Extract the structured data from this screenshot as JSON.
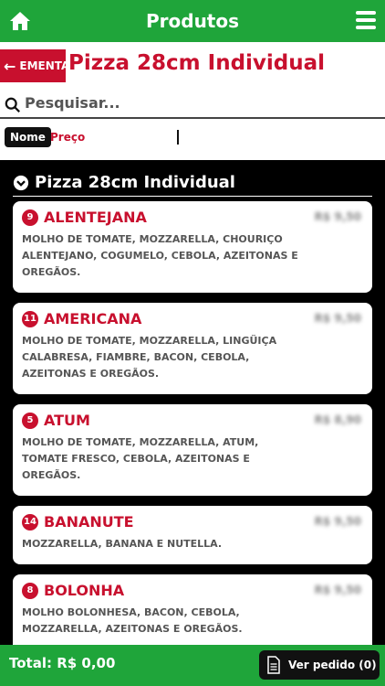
{
  "topbar": {
    "title": "Produtos"
  },
  "header": {
    "back_label": "EMENTA",
    "title": "Pizza 28cm Individual"
  },
  "search": {
    "placeholder": "Pesquisar..."
  },
  "sort": {
    "name_label": "Nome",
    "price_label": "Preço"
  },
  "section": {
    "title": "Pizza 28cm Individual"
  },
  "products": [
    {
      "badge": "9",
      "name": "ALENTEJANA",
      "price": "R$ 9,50",
      "desc_lines": [
        "MOLHO DE TOMATE, MOZZARELLA, CHOURIÇO",
        "ALENTEJANO, COGUMELO, CEBOLA, AZEITONAS E",
        "OREGÃOS."
      ]
    },
    {
      "badge": "11",
      "name": "AMERICANA",
      "price": "R$ 9,50",
      "desc_lines": [
        "MOLHO DE TOMATE, MOZZARELLA, LINGÜIÇA",
        "CALABRESA, FIAMBRE, BACON, CEBOLA,",
        "AZEITONAS E OREGÃOS."
      ]
    },
    {
      "badge": "5",
      "name": "ATUM",
      "price": "R$ 8,90",
      "desc_lines": [
        "MOLHO DE TOMATE, MOZZARELLA, ATUM,",
        "TOMATE FRESCO, CEBOLA, AZEITONAS E",
        "OREGÃOS."
      ]
    },
    {
      "badge": "14",
      "name": "BANANUTE",
      "price": "R$ 9,50",
      "desc_lines": [
        "MOZZARELLA, BANANA E NUTELLA."
      ]
    },
    {
      "badge": "8",
      "name": "BOLONHA",
      "price": "R$ 9,50",
      "desc_lines": [
        "MOLHO BOLONHESA, BACON, CEBOLA,",
        "MOZZARELLA, AZEITONAS E OREGÃOS."
      ]
    }
  ],
  "footer": {
    "total": "Total: R$ 0,00",
    "order_label": "Ver pedido (0)"
  },
  "colors": {
    "green": "#1fa53a",
    "red": "#c8102e"
  }
}
